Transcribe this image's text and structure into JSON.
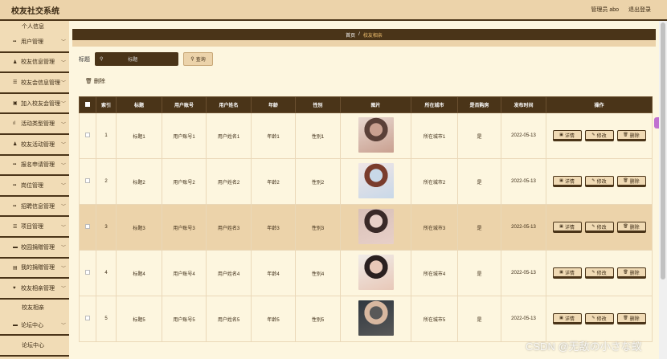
{
  "app": {
    "title": "校友社交系统"
  },
  "topbar": {
    "user": "管理员 abo",
    "logout": "退出登录"
  },
  "sidebar": {
    "personal": "个人信息",
    "items": [
      {
        "label": "用户管理",
        "icon": "grid-icon",
        "glyph": "▪▪"
      },
      {
        "label": "校友信息管理",
        "icon": "user-icon",
        "glyph": "♟"
      },
      {
        "label": "校友会信息管理",
        "icon": "list-icon",
        "glyph": "☰"
      },
      {
        "label": "加入校友会管理",
        "icon": "box-icon",
        "glyph": "▣"
      },
      {
        "label": "活动类型管理",
        "icon": "chart-icon",
        "glyph": "ıl"
      },
      {
        "label": "校友活动管理",
        "icon": "user-icon",
        "glyph": "♟"
      },
      {
        "label": "报名申请管理",
        "icon": "grid-icon",
        "glyph": "▪▪"
      },
      {
        "label": "岗位管理",
        "icon": "grid-icon",
        "glyph": "▪▪"
      },
      {
        "label": "招聘信息管理",
        "icon": "grid-icon",
        "glyph": "▪▪"
      },
      {
        "label": "项目管理",
        "icon": "list-icon",
        "glyph": "☰"
      },
      {
        "label": "校园捐赠管理",
        "icon": "card-icon",
        "glyph": "▬"
      },
      {
        "label": "我的捐赠管理",
        "icon": "doc-icon",
        "glyph": "▤"
      },
      {
        "label": "校友相亲管理",
        "icon": "heart-icon",
        "glyph": "♥"
      }
    ],
    "notice": "校友相亲",
    "forum": {
      "label": "论坛中心",
      "icon": "card-icon",
      "glyph": "▬"
    },
    "forum_center": "论坛中心"
  },
  "breadcrumb": {
    "home": "首页",
    "sep": "/",
    "current": "校友相亲"
  },
  "search": {
    "label": "标题",
    "placeholder": "标题",
    "button": "查询"
  },
  "toolbar": {
    "delete": "删除"
  },
  "table": {
    "headers": [
      "索引",
      "标题",
      "用户账号",
      "用户姓名",
      "年龄",
      "性别",
      "图片",
      "所在城市",
      "是否购房",
      "发布时间",
      "操作"
    ],
    "actions": {
      "detail": "详情",
      "edit": "修改",
      "delete": "删除"
    },
    "rows": [
      {
        "index": "1",
        "title": "标题1",
        "account": "用户账号1",
        "name": "用户姓名1",
        "age": "年龄1",
        "gender": "性别1",
        "city": "所在城市1",
        "house": "是",
        "date": "2022-05-13",
        "photo_colors": [
          "#e8d8d0",
          "#5a4038",
          "#c9a090"
        ]
      },
      {
        "index": "2",
        "title": "标题2",
        "account": "用户账号2",
        "name": "用户姓名2",
        "age": "年龄2",
        "gender": "性别2",
        "city": "所在城市2",
        "house": "是",
        "date": "2022-05-13",
        "photo_colors": [
          "#f0e6e6",
          "#7a3c2c",
          "#c8d8e8"
        ]
      },
      {
        "index": "3",
        "title": "标题3",
        "account": "用户账号3",
        "name": "用户姓名3",
        "age": "年龄3",
        "gender": "性别3",
        "city": "所在城市3",
        "house": "是",
        "date": "2022-05-13",
        "photo_colors": [
          "#d8c0b8",
          "#3a2a28",
          "#e8d0c8"
        ]
      },
      {
        "index": "4",
        "title": "标题4",
        "account": "用户账号4",
        "name": "用户姓名4",
        "age": "年龄4",
        "gender": "性别4",
        "city": "所在城市4",
        "house": "是",
        "date": "2022-05-13",
        "photo_colors": [
          "#f0ece8",
          "#2a2020",
          "#e8c8b8"
        ]
      },
      {
        "index": "5",
        "title": "标题5",
        "account": "用户账号5",
        "name": "用户姓名5",
        "age": "年龄5",
        "gender": "性别5",
        "city": "所在城市5",
        "house": "是",
        "date": "2022-05-13",
        "photo_colors": [
          "#303840",
          "#d8b8a0",
          "#585858"
        ]
      }
    ]
  },
  "watermark": "CSDN @无敌の小さな蚁"
}
